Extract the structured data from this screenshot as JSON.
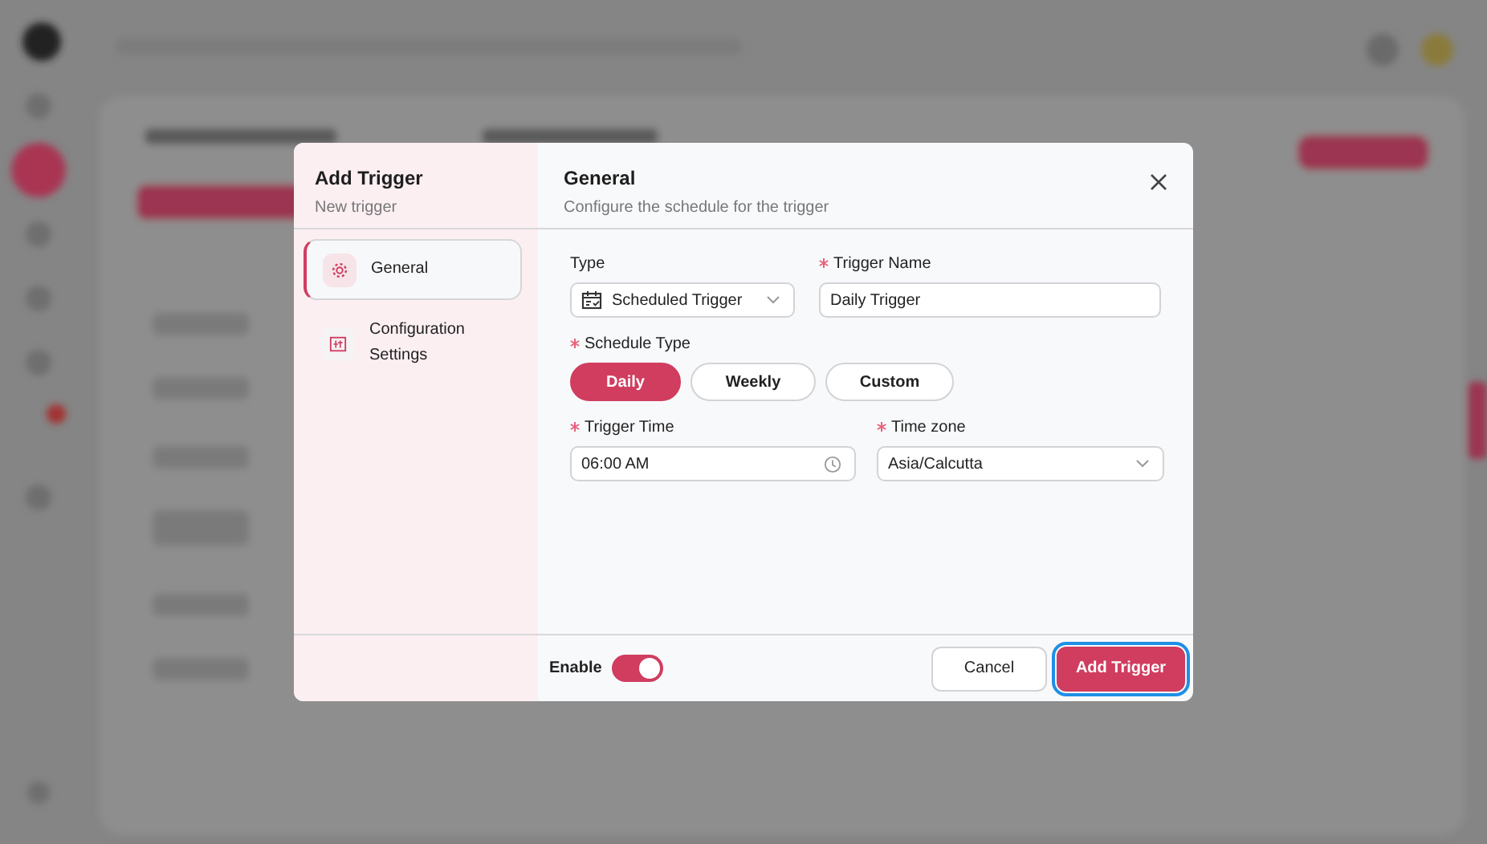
{
  "dialog": {
    "title": "Add Trigger",
    "subtitle": "New trigger"
  },
  "steps": [
    {
      "label": "General",
      "kind": "gear",
      "selected": true
    },
    {
      "label": "Configuration Settings",
      "kind": "panel",
      "selected": false
    }
  ],
  "section": {
    "title": "General",
    "description": "Configure the schedule for the trigger"
  },
  "type_field": {
    "label": "Type",
    "required": false,
    "value": "Scheduled Trigger"
  },
  "name_field": {
    "label": "Trigger Name",
    "required": true,
    "value": "Daily Trigger"
  },
  "schedule": {
    "label": "Schedule Type",
    "required": true,
    "options": [
      {
        "label": "Daily",
        "selected": true
      },
      {
        "label": "Weekly",
        "selected": false
      },
      {
        "label": "Custom",
        "selected": false
      }
    ]
  },
  "time_field": {
    "label": "Trigger Time",
    "required": true,
    "value": "06:00 AM"
  },
  "timezone_field": {
    "label": "Time zone",
    "required": true,
    "value": "Asia/Calcutta"
  },
  "footer": {
    "enable_label": "Enable",
    "enable_on": true,
    "buttons": [
      {
        "label": "Cancel",
        "kind": "secondary",
        "focused": false
      },
      {
        "label": "Add Trigger",
        "kind": "primary",
        "focused": true
      }
    ]
  }
}
